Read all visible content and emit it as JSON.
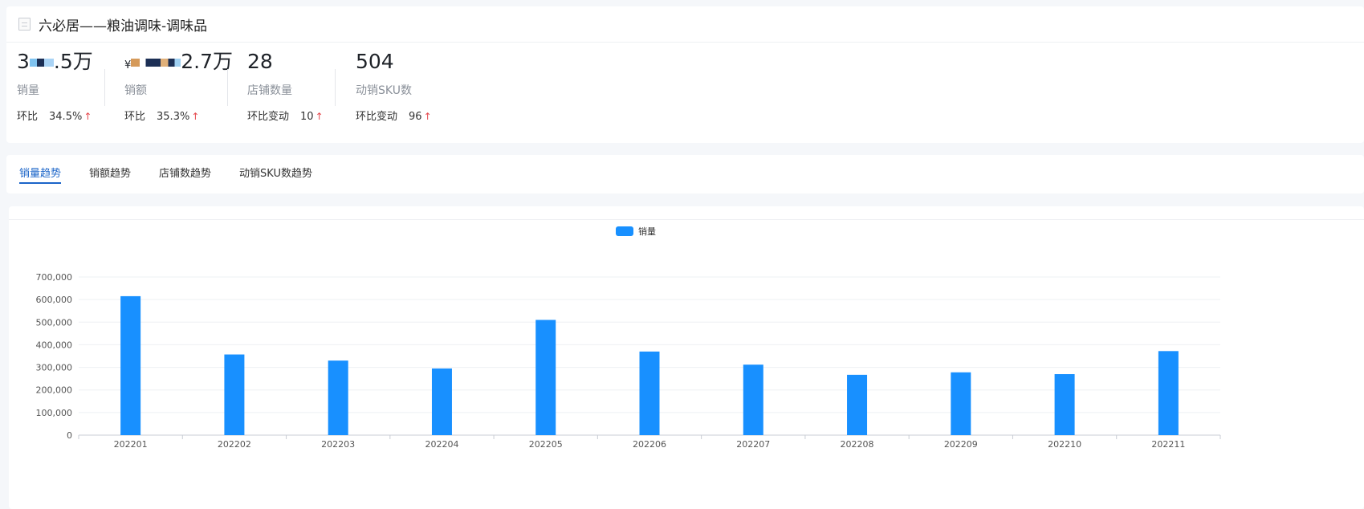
{
  "header": {
    "title": "六必居——粮油调味-调味品"
  },
  "metrics": [
    {
      "value_prefix": "3",
      "value_suffix": ".5万",
      "label": "销量",
      "change_label": "环比",
      "change_value": "34.5%",
      "arrow": "↑"
    },
    {
      "value_prefix": "¥",
      "value_suffix": "2.7万",
      "label": "销额",
      "change_label": "环比",
      "change_value": "35.3%",
      "arrow": "↑"
    },
    {
      "value": "28",
      "label": "店铺数量",
      "change_label": "环比变动",
      "change_value": "10",
      "arrow": "↑"
    },
    {
      "value": "504",
      "label": "动销SKU数",
      "change_label": "环比变动",
      "change_value": "96",
      "arrow": "↑"
    }
  ],
  "tabs": [
    {
      "label": "销量趋势",
      "active": true
    },
    {
      "label": "销额趋势",
      "active": false
    },
    {
      "label": "店铺数趋势",
      "active": false
    },
    {
      "label": "动销SKU数趋势",
      "active": false
    }
  ],
  "colors": {
    "bar": "#1890ff",
    "accent": "#1a64c8",
    "up_arrow": "#e5484d"
  },
  "chart_data": {
    "type": "bar",
    "legend": "销量",
    "legend_position": "top-center",
    "grid": true,
    "categories": [
      "202201",
      "202202",
      "202203",
      "202204",
      "202205",
      "202206",
      "202207",
      "202208",
      "202209",
      "202210",
      "202211"
    ],
    "series": [
      {
        "name": "销量",
        "values": [
          615000,
          357000,
          330000,
          295000,
          510000,
          370000,
          312000,
          267000,
          278000,
          270000,
          372000
        ]
      }
    ],
    "ylim": [
      0,
      700000
    ],
    "yticks": [
      0,
      100000,
      200000,
      300000,
      400000,
      500000,
      600000,
      700000
    ],
    "ytick_labels": [
      "0",
      "100,000",
      "200,000",
      "300,000",
      "400,000",
      "500,000",
      "600,000",
      "700,000"
    ]
  }
}
